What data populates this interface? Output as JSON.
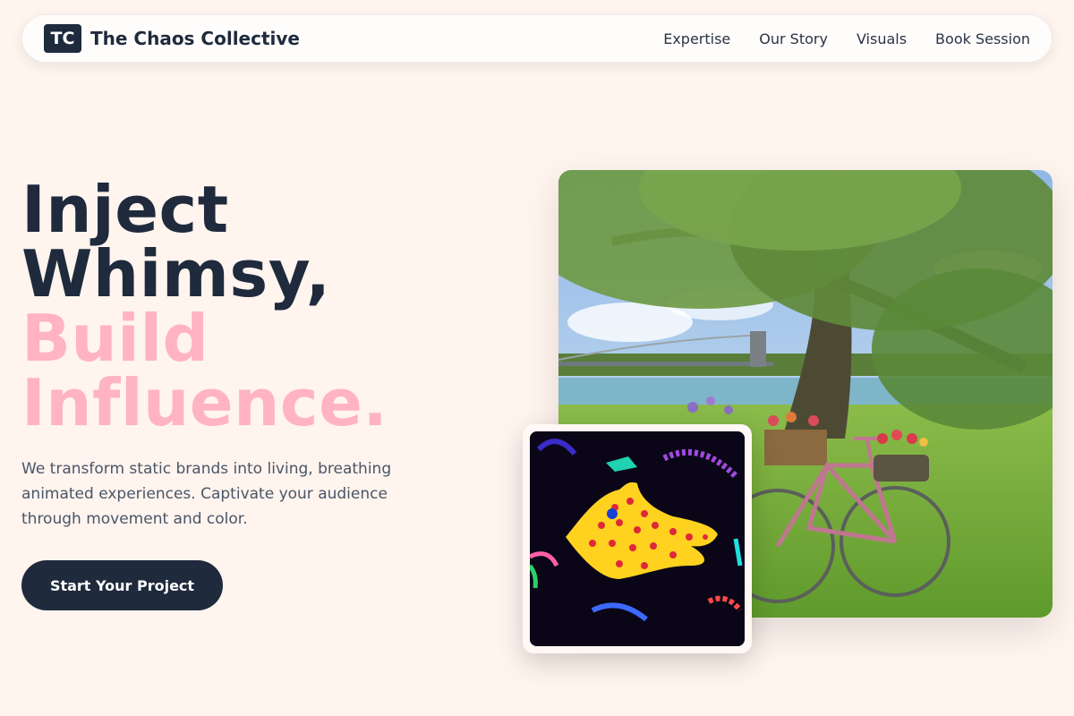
{
  "header": {
    "logo_initials": "TC",
    "brand_name": "The Chaos Collective",
    "nav": [
      {
        "label": "Expertise"
      },
      {
        "label": "Our Story"
      },
      {
        "label": "Visuals"
      },
      {
        "label": "Book Session"
      }
    ]
  },
  "hero": {
    "title_line1": "Inject",
    "title_line2": "Whimsy,",
    "title_line3": "Build",
    "title_line4": "Influence.",
    "description": "We transform static brands into living, breathing animated experiences. Captivate your audience through movement and color.",
    "cta_label": "Start Your Project"
  },
  "colors": {
    "background": "#fff4ee",
    "navy": "#1f2a3d",
    "pink_accent": "#ffb3c3"
  },
  "images": {
    "main": "bicycle-under-tree-photo",
    "secondary": "yellow-polka-dot-creature-art"
  }
}
